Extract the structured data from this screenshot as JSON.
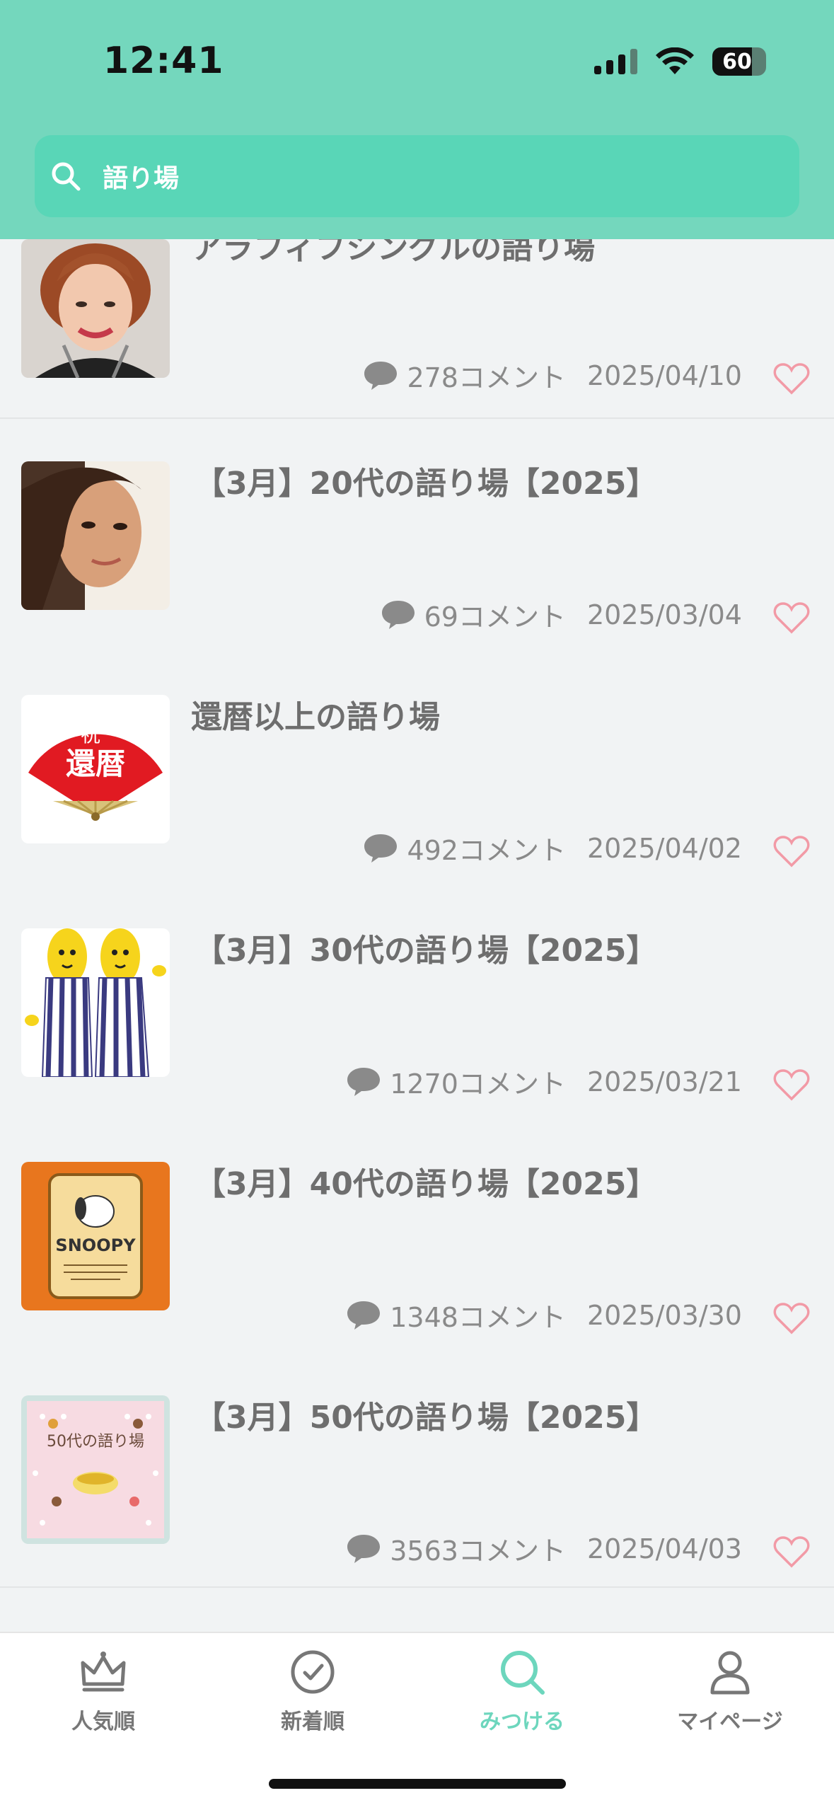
{
  "status": {
    "time": "12:41",
    "battery": "60"
  },
  "search": {
    "label": "語り場"
  },
  "items": [
    {
      "title": "アラフィフシングルの語り場",
      "comments": "278コメント",
      "date": "2025/04/10",
      "thumb": "portrait-elderly-woman"
    },
    {
      "title": "【3月】20代の語り場【2025】",
      "comments": "69コメント",
      "date": "2025/03/04",
      "thumb": "portrait-young-woman"
    },
    {
      "title": "還暦以上の語り場",
      "comments": "492コメント",
      "date": "2025/04/02",
      "thumb": "red-fan",
      "thumb_text_top": "祝",
      "thumb_text_main": "還暦"
    },
    {
      "title": "【3月】30代の語り場【2025】",
      "comments": "1270コメント",
      "date": "2025/03/21",
      "thumb": "bananas-in-pajamas"
    },
    {
      "title": "【3月】40代の語り場【2025】",
      "comments": "1348コメント",
      "date": "2025/03/30",
      "thumb": "snoopy-poster",
      "thumb_text": "SNOOPY"
    },
    {
      "title": "【3月】50代の語り場【2025】",
      "comments": "3563コメント",
      "date": "2025/04/03",
      "thumb": "pink-sweets-card",
      "thumb_text": "50代の語り場"
    }
  ],
  "tabs": [
    {
      "label": "人気順",
      "icon": "crown-icon"
    },
    {
      "label": "新着順",
      "icon": "clock-icon"
    },
    {
      "label": "みつける",
      "icon": "search-icon",
      "active": true
    },
    {
      "label": "マイページ",
      "icon": "person-icon"
    }
  ],
  "colors": {
    "header": "#74d7bd",
    "search_bg": "#59d6b7",
    "active_tab": "#6dd6bd",
    "heart": "#f29aa6"
  }
}
